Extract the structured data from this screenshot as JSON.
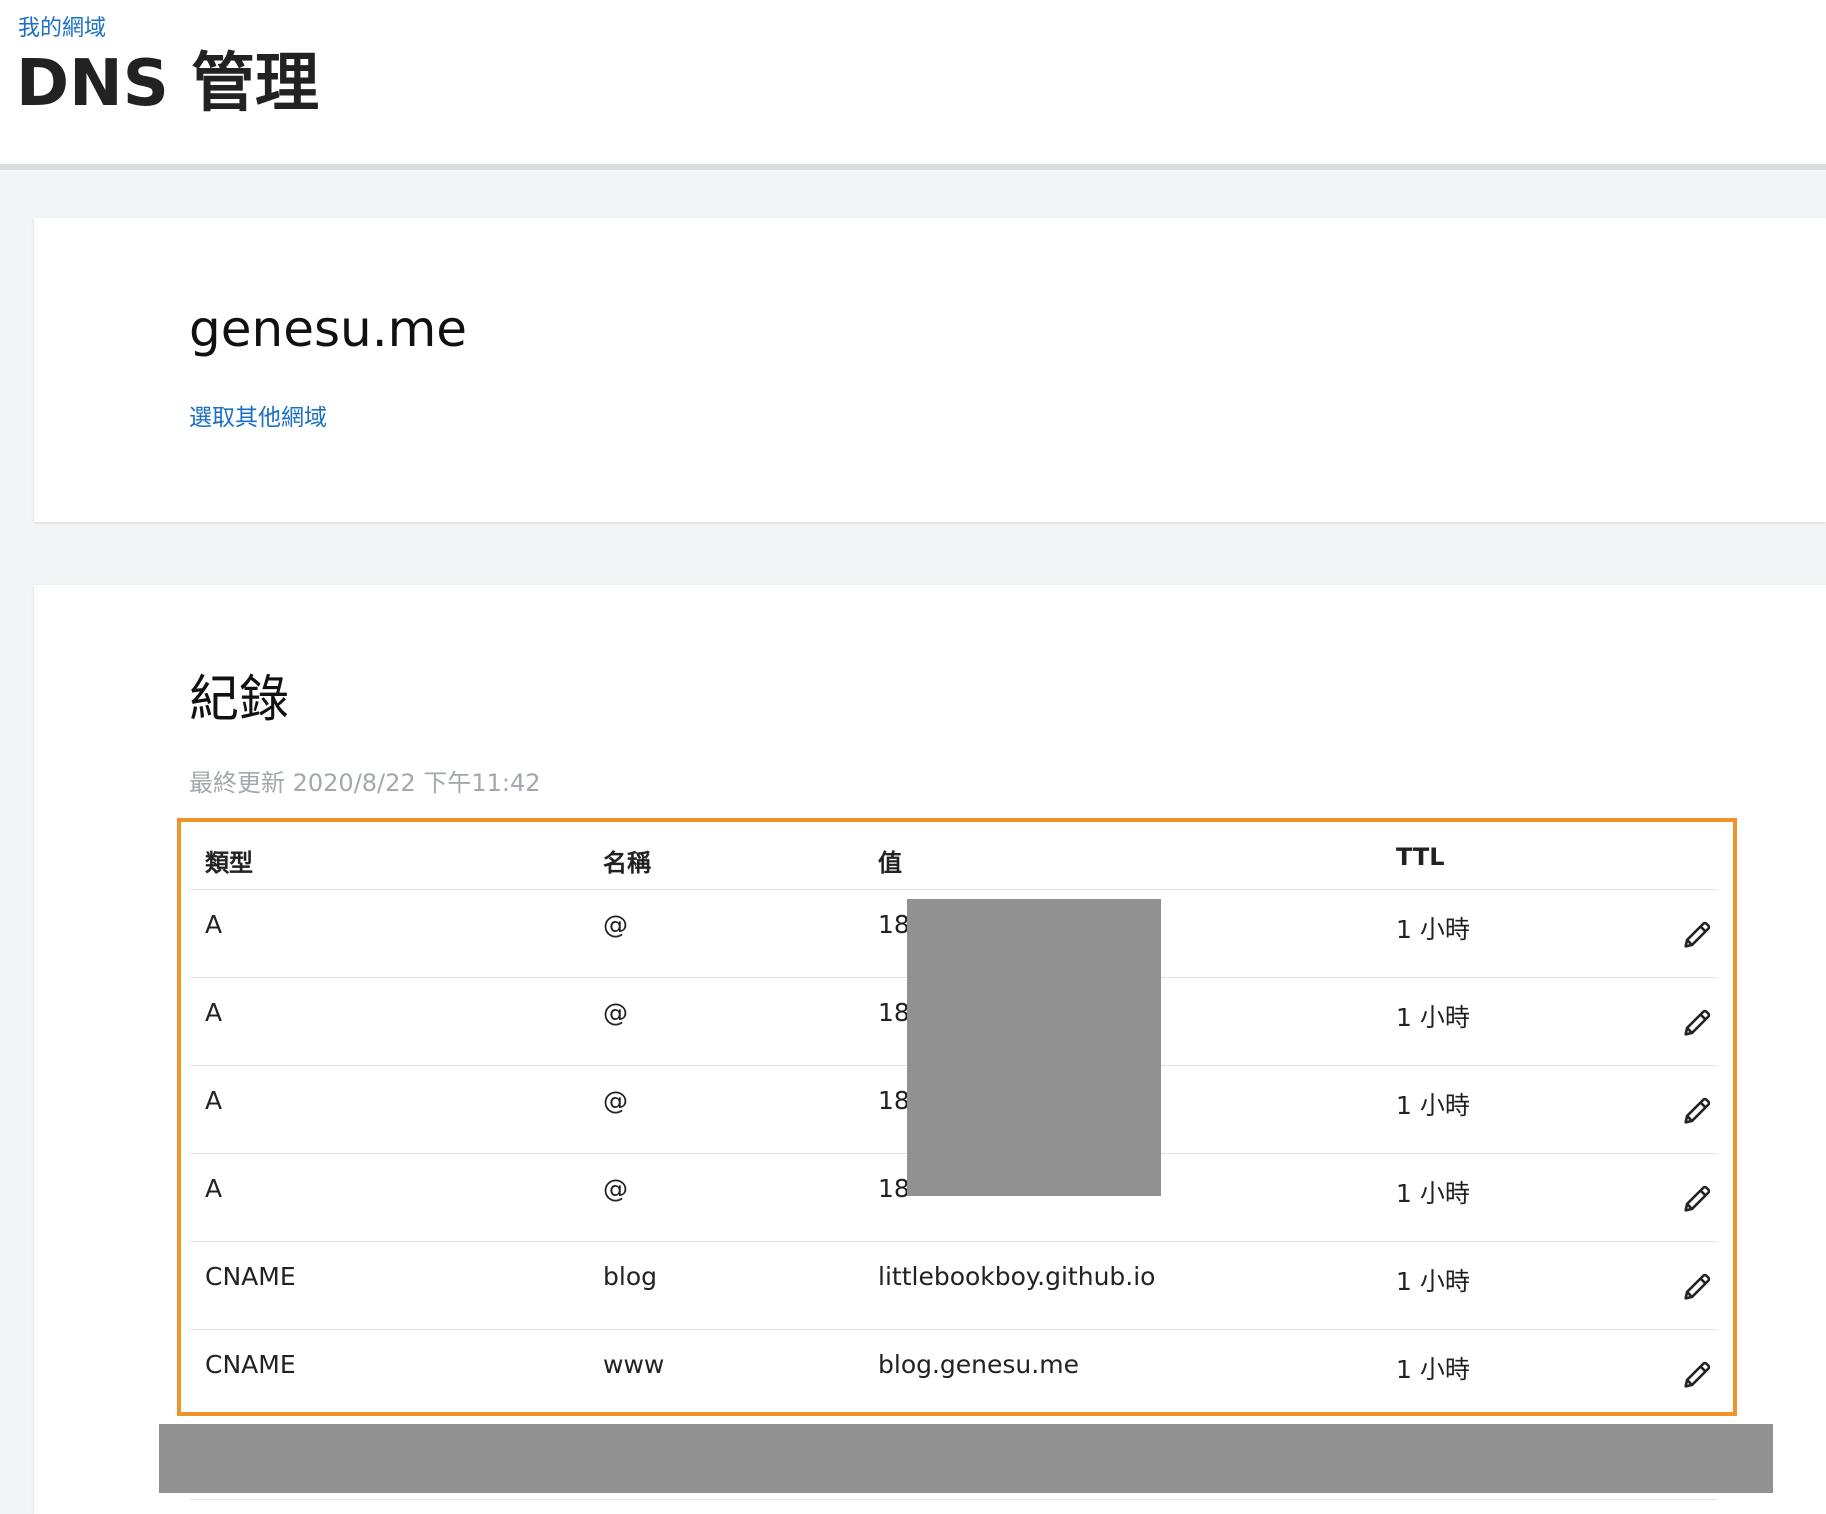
{
  "header": {
    "breadcrumb": "我的網域",
    "title": "DNS 管理"
  },
  "domain_card": {
    "domain": "genesu.me",
    "switch_link": "選取其他網域"
  },
  "records": {
    "title": "紀錄",
    "last_updated": "最終更新 2020/8/22 下午11:42",
    "columns": [
      "類型",
      "名稱",
      "值",
      "TTL"
    ],
    "rows": [
      {
        "type": "A",
        "name": "@",
        "value": "18",
        "ttl": "1 小時"
      },
      {
        "type": "A",
        "name": "@",
        "value": "18",
        "ttl": "1 小時"
      },
      {
        "type": "A",
        "name": "@",
        "value": "18",
        "ttl": "1 小時"
      },
      {
        "type": "A",
        "name": "@",
        "value": "18",
        "ttl": "1 小時"
      },
      {
        "type": "CNAME",
        "name": "blog",
        "value": "littlebookboy.github.io",
        "ttl": "1 小時"
      },
      {
        "type": "CNAME",
        "name": "www",
        "value": "blog.genesu.me",
        "ttl": "1 小時"
      }
    ],
    "edit_icon": "pencil-icon"
  },
  "colors": {
    "link": "#1b6fc7",
    "highlight": "#f0932b",
    "redaction": "#919191",
    "muted_text": "#a3a8ae"
  }
}
